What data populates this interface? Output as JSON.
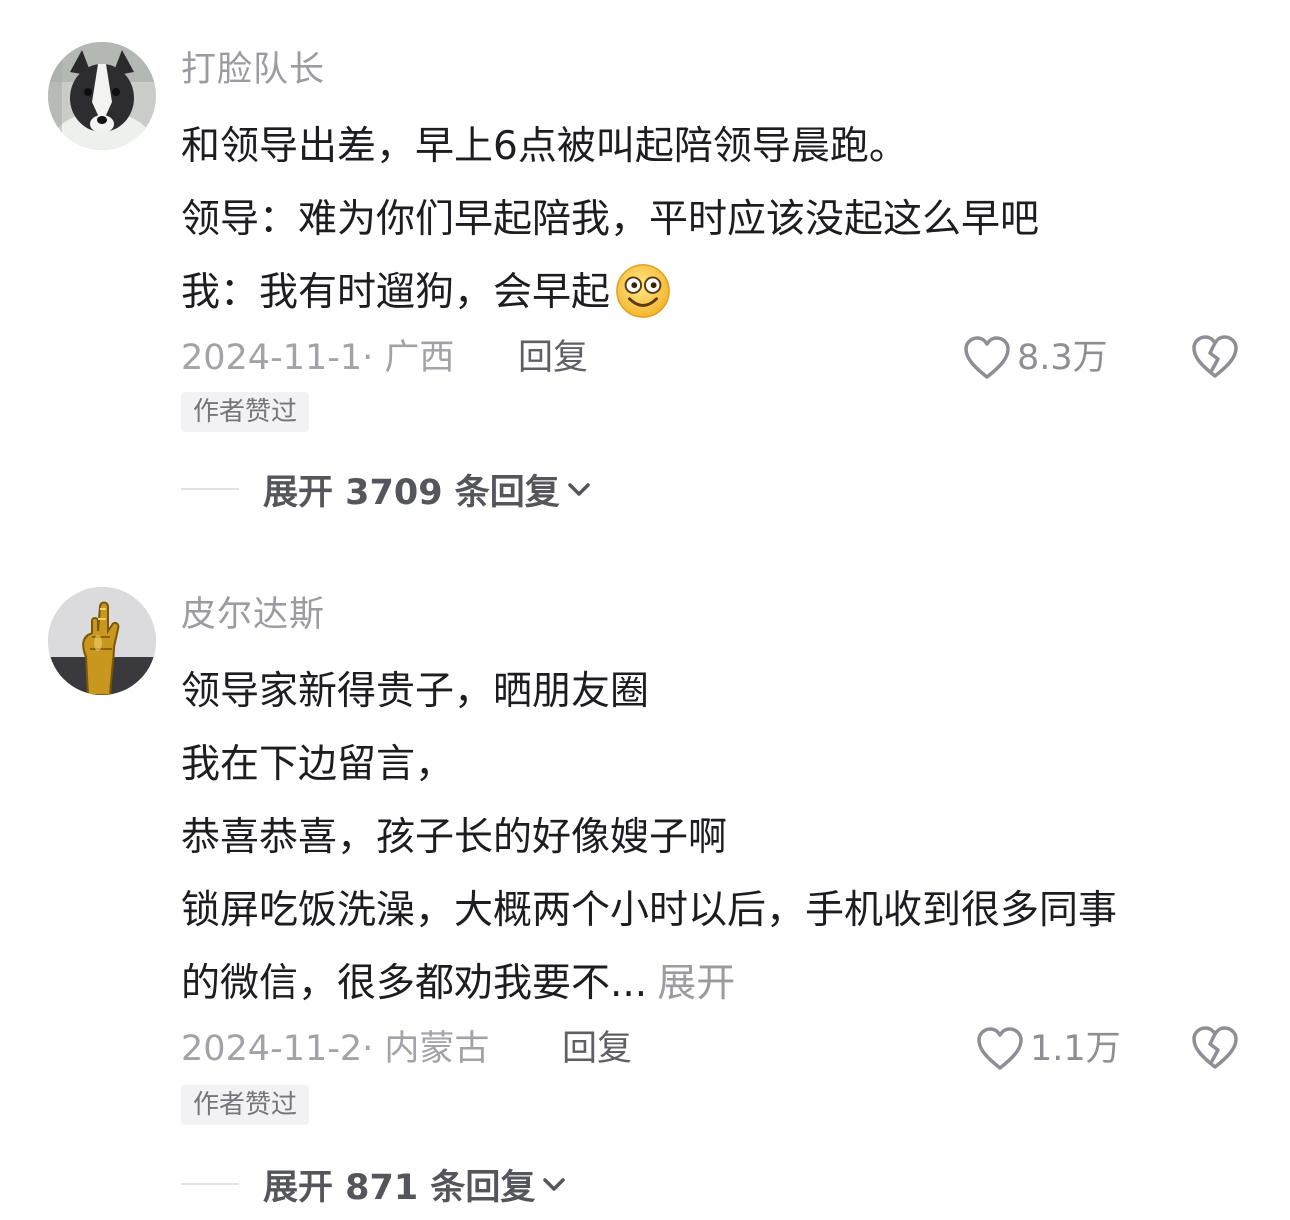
{
  "comments": [
    {
      "username": "打脸队长",
      "avatar_icon": "dog-avatar",
      "lines": [
        "和领导出差，早上6点被叫起陪领导晨跑。",
        "领导：难为你们早起陪我，平时应该没起这么早吧",
        "我：我有时遛狗，会早起"
      ],
      "trailing_emoji": "smiley-emoji",
      "date_location": "2024-11-1· 广西",
      "reply_label": "回复",
      "like_count": "8.3万",
      "badge": "作者赞过",
      "expand_label": "展开 3709 条回复"
    },
    {
      "username": "皮尔达斯",
      "avatar_icon": "golden-hand-avatar",
      "lines": [
        "领导家新得贵子，晒朋友圈",
        "我在下边留言，",
        "恭喜恭喜，孩子长的好像嫂子啊",
        "锁屏吃饭洗澡，大概两个小时以后，手机收到很多同事",
        "的微信，很多都劝我要不..."
      ],
      "more_label": "展开",
      "date_location": "2024-11-2· 内蒙古",
      "reply_label": "回复",
      "like_count": "1.1万",
      "badge": "作者赞过",
      "expand_label": "展开 871 条回复"
    }
  ],
  "icons": {
    "like": "heart-icon",
    "dislike": "broken-heart-icon",
    "expand": "chevron-down-icon"
  },
  "colors": {
    "username": "#9b9ba1",
    "body_text": "#1c1c21",
    "meta": "#a2a2a8",
    "badge_bg": "#f2f2f4"
  }
}
